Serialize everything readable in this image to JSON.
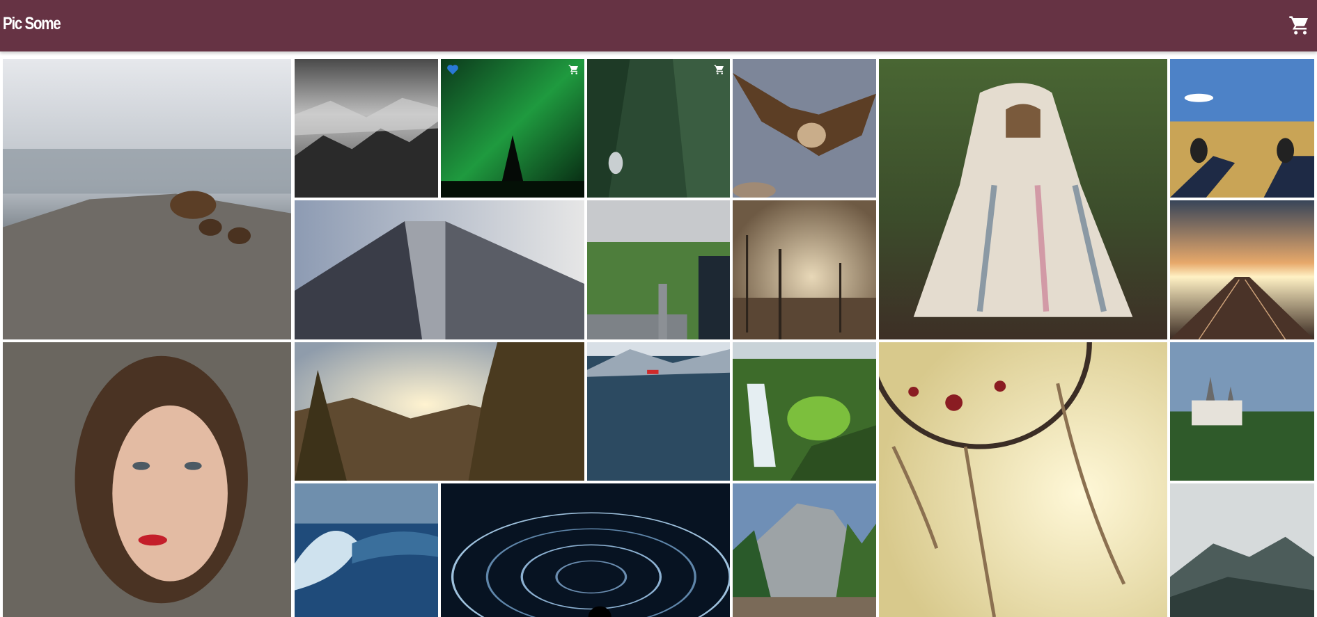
{
  "header": {
    "title": "Pic Some",
    "background": "#663344",
    "cart_icon": "shopping-cart-icon"
  },
  "gallery": {
    "favorited_icon": "heart-icon",
    "in_cart_icon": "shopping-cart-icon",
    "photos": [
      {
        "subject": "bear-with-cubs",
        "favorited": false,
        "in_cart": false
      },
      {
        "subject": "foggy-forest",
        "favorited": false,
        "in_cart": false
      },
      {
        "subject": "northern-lights",
        "favorited": true,
        "in_cart": true
      },
      {
        "subject": "forest-climber",
        "favorited": false,
        "in_cart": true
      },
      {
        "subject": "vulture-in-flight",
        "favorited": false,
        "in_cart": false
      },
      {
        "subject": "pug-in-blanket",
        "favorited": false,
        "in_cart": false
      },
      {
        "subject": "sneakers-in-field",
        "favorited": false,
        "in_cart": false
      },
      {
        "subject": "skyscraper",
        "favorited": false,
        "in_cart": false
      },
      {
        "subject": "city-park",
        "favorited": false,
        "in_cart": false
      },
      {
        "subject": "dead-trees-sunset",
        "favorited": false,
        "in_cart": false
      },
      {
        "subject": "train-yard-sunset",
        "favorited": false,
        "in_cart": false
      },
      {
        "subject": "woman-portrait",
        "favorited": false,
        "in_cart": false
      },
      {
        "subject": "valley-sunrise",
        "favorited": false,
        "in_cart": false
      },
      {
        "subject": "lake-red-boat",
        "favorited": false,
        "in_cart": false
      },
      {
        "subject": "waterfall",
        "favorited": false,
        "in_cart": false
      },
      {
        "subject": "dreamcatcher",
        "favorited": false,
        "in_cart": false
      },
      {
        "subject": "castle",
        "favorited": false,
        "in_cart": false
      },
      {
        "subject": "ocean-wave",
        "favorited": false,
        "in_cart": false
      },
      {
        "subject": "star-trails",
        "favorited": false,
        "in_cart": false
      },
      {
        "subject": "yosemite",
        "favorited": false,
        "in_cart": false
      },
      {
        "subject": "misty-mountains",
        "favorited": false,
        "in_cart": false
      }
    ]
  }
}
